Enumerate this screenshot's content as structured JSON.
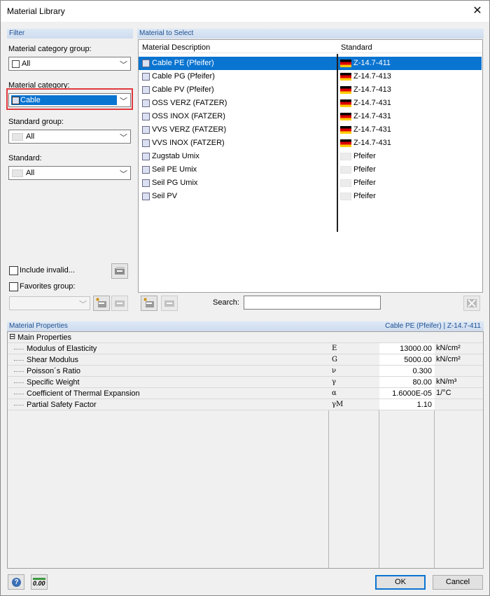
{
  "window": {
    "title": "Material Library",
    "close_glyph": "✕"
  },
  "filter": {
    "panel_title": "Filter",
    "category_group_label": "Material category group:",
    "category_group_value": "All",
    "category_label": "Material category:",
    "category_value": "Cable",
    "standard_group_label": "Standard group:",
    "standard_group_value": "All",
    "standard_label": "Standard:",
    "standard_value": "All",
    "include_invalid_label": "Include invalid...",
    "favorites_label": "Favorites group:"
  },
  "materials": {
    "panel_title": "Material to Select",
    "columns": [
      "Material Description",
      "Standard"
    ],
    "rows": [
      {
        "name": "Cable PE (Pfeifer)",
        "standard": "Z-14.7-411",
        "flag": "de",
        "selected": true
      },
      {
        "name": "Cable PG (Pfeifer)",
        "standard": "Z-14.7-413",
        "flag": "de"
      },
      {
        "name": "Cable PV (Pfeifer)",
        "standard": "Z-14.7-413",
        "flag": "de"
      },
      {
        "name": "OSS VERZ (FATZER)",
        "standard": "Z-14.7-431",
        "flag": "de"
      },
      {
        "name": "OSS INOX (FATZER)",
        "standard": "Z-14.7-431",
        "flag": "de"
      },
      {
        "name": "VVS VERZ (FATZER)",
        "standard": "Z-14.7-431",
        "flag": "de"
      },
      {
        "name": "VVS INOX (FATZER)",
        "standard": "Z-14.7-431",
        "flag": "de"
      },
      {
        "name": "Zugstab Umix",
        "standard": "Pfeifer",
        "flag": "blank"
      },
      {
        "name": "Seil PE Umix",
        "standard": "Pfeifer",
        "flag": "blank"
      },
      {
        "name": "Seil PG Umix",
        "standard": "Pfeifer",
        "flag": "blank"
      },
      {
        "name": "Seil PV",
        "standard": "Pfeifer",
        "flag": "blank"
      }
    ],
    "search_label": "Search:",
    "search_value": ""
  },
  "properties": {
    "panel_title": "Material Properties",
    "selected_caption": "Cable PE (Pfeifer)  |  Z-14.7-411",
    "group_label": "Main Properties",
    "collapse_glyph": "⊟",
    "rows": [
      {
        "name": "Modulus of Elasticity",
        "symbol": "E",
        "value": "13000.00",
        "unit": "kN/cm²"
      },
      {
        "name": "Shear Modulus",
        "symbol": "G",
        "value": "5000.00",
        "unit": "kN/cm²"
      },
      {
        "name": "Poisson´s Ratio",
        "symbol": "ν",
        "value": "0.300",
        "unit": ""
      },
      {
        "name": "Specific Weight",
        "symbol": "γ",
        "value": "80.00",
        "unit": "kN/m³"
      },
      {
        "name": "Coefficient of Thermal Expansion",
        "symbol": "α",
        "value": "1.6000E-05",
        "unit": "1/°C"
      },
      {
        "name": "Partial Safety Factor",
        "symbol": "γM",
        "value": "1.10",
        "unit": ""
      }
    ]
  },
  "footer": {
    "ok_label": "OK",
    "cancel_label": "Cancel",
    "help_glyph": "?",
    "units_glyph": "0.00"
  }
}
